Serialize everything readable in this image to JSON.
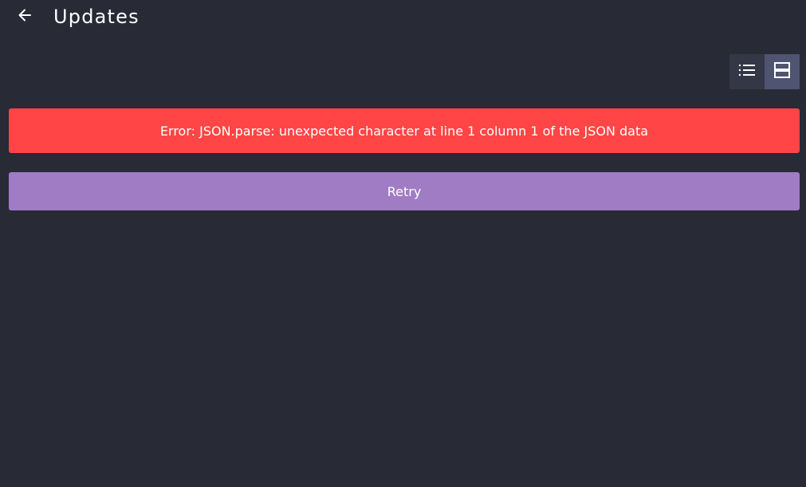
{
  "header": {
    "title": "Updates",
    "back_icon": "arrow-left-icon"
  },
  "view_toggle": {
    "list_icon": "list-icon",
    "card_icon": "card-view-icon",
    "selected": "card"
  },
  "error": {
    "message": "Error: JSON.parse: unexpected character at line 1 column 1 of the JSON data"
  },
  "actions": {
    "retry_label": "Retry"
  },
  "colors": {
    "background": "#282a36",
    "error": "#ff4545",
    "accent": "#a07cc5",
    "toggle_active": "#4f5470",
    "toggle_inactive": "#343746"
  }
}
